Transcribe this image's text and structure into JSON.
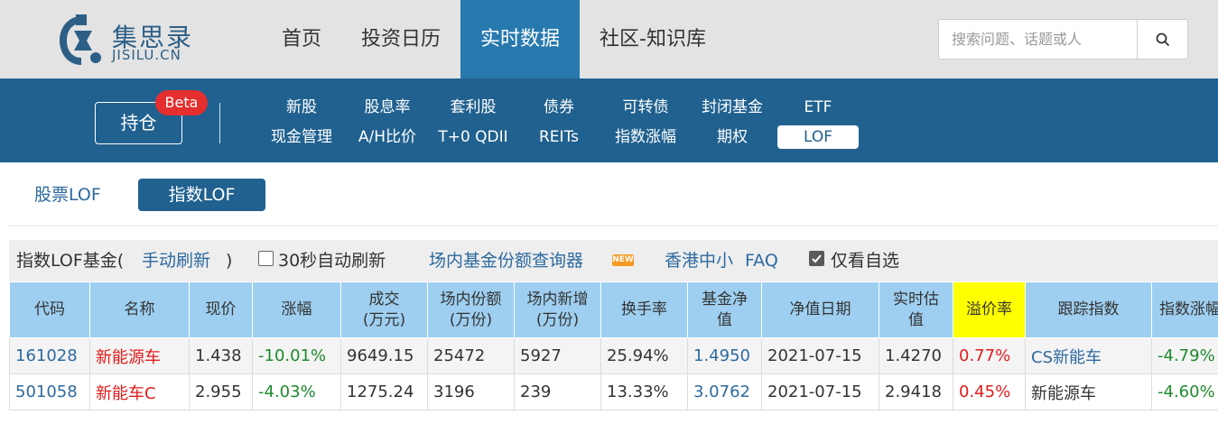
{
  "brand": {
    "cn": "集思录",
    "en": "JISILU.CN"
  },
  "main_nav": [
    "首页",
    "投资日历",
    "实时数据",
    "社区-知识库"
  ],
  "search": {
    "placeholder": "搜索问题、话题或人"
  },
  "sub_nav": {
    "hold_label": "持仓",
    "beta_label": "Beta",
    "row1": [
      "新股",
      "股息率",
      "套利股",
      "债券",
      "可转债",
      "封闭基金",
      "ETF"
    ],
    "row2": [
      "现金管理",
      "A/H比价",
      "T+0 QDII",
      "REITs",
      "指数涨幅",
      "期权",
      "LOF"
    ]
  },
  "lof_tabs": [
    "股票LOF",
    "指数LOF"
  ],
  "caption": {
    "title": "指数LOF基金(",
    "refresh": "手动刷新",
    "close_paren": ")",
    "auto_refresh": "30秒自动刷新",
    "query_link": "场内基金份额查询器",
    "new_badge": "NEW",
    "hk_small": "香港中小",
    "faq": "FAQ",
    "only_fav": "仅看自选"
  },
  "table": {
    "headers": [
      [
        "代码"
      ],
      [
        "名称"
      ],
      [
        "现价"
      ],
      [
        "涨幅"
      ],
      [
        "成交",
        "(万元)"
      ],
      [
        "场内份额",
        "(万份)"
      ],
      [
        "场内新增",
        "(万份)"
      ],
      [
        "换手率"
      ],
      [
        "基金净",
        "值"
      ],
      [
        "净值日期"
      ],
      [
        "实时估",
        "值"
      ],
      [
        "溢价率"
      ],
      [
        "跟踪指数"
      ],
      [
        "指数涨幅"
      ]
    ],
    "rows": [
      {
        "code": "161028",
        "name": "新能源车",
        "price": "1.438",
        "change": "-10.01%",
        "turnover": "9649.15",
        "shares": "25472",
        "new_shares": "5927",
        "turnover_rate": "25.94%",
        "nav": "1.4950",
        "nav_date": "2021-07-15",
        "est": "1.4270",
        "premium": "0.77%",
        "index": "CS新能车",
        "index_change": "-4.79%"
      },
      {
        "code": "501058",
        "name": "新能车C",
        "price": "2.955",
        "change": "-4.03%",
        "turnover": "1275.24",
        "shares": "3196",
        "new_shares": "239",
        "turnover_rate": "13.33%",
        "nav": "3.0762",
        "nav_date": "2021-07-15",
        "est": "2.9418",
        "premium": "0.45%",
        "index": "新能源车",
        "index_change": "-4.60%"
      }
    ]
  },
  "colors": {
    "header_blue": "#20618f",
    "active_nav": "#2779ae",
    "table_head": "#9ecff0",
    "highlight": "#ffff00"
  }
}
